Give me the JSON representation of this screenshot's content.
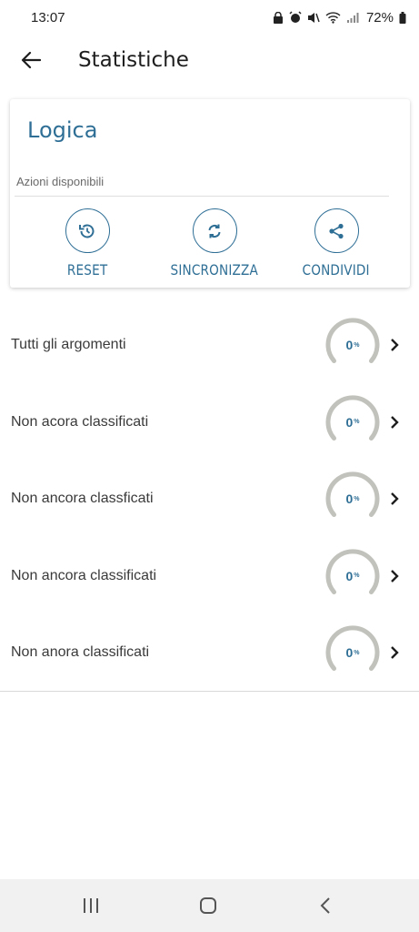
{
  "status_bar": {
    "time": "13:07",
    "battery": "72%"
  },
  "app_bar": {
    "title": "Statistiche"
  },
  "card": {
    "title": "Logica",
    "subtitle": "Azioni disponibili",
    "actions": [
      {
        "label": "RESET",
        "icon": "history-icon"
      },
      {
        "label": "SINCRONIZZA",
        "icon": "sync-icon"
      },
      {
        "label": "CONDIVIDI",
        "icon": "share-icon"
      }
    ]
  },
  "stats": [
    {
      "label": "Tutti gli argomenti",
      "value": "0",
      "unit": "%"
    },
    {
      "label": "Non acora classificati",
      "value": "0",
      "unit": "%"
    },
    {
      "label": "Non ancora classficati",
      "value": "0",
      "unit": "%"
    },
    {
      "label": "Non ancora classificati",
      "value": "0",
      "unit": "%"
    },
    {
      "label": "Non anora classificati",
      "value": "0",
      "unit": "%"
    }
  ],
  "colors": {
    "accent": "#2f6f96",
    "gauge_track": "#c2c2bc"
  },
  "nav": {
    "buttons": [
      "recents-icon",
      "home-icon",
      "back-icon"
    ]
  }
}
